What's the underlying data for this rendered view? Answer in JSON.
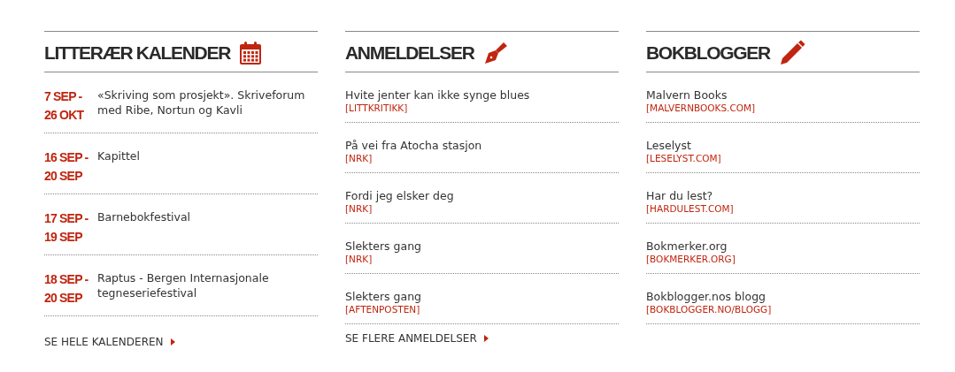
{
  "calendar": {
    "title": "LITTERÆR KALENDER",
    "events": [
      {
        "date_start": "7 SEP -",
        "date_end": "26 OKT",
        "title": "«Skriving som prosjekt». Skriveforum med Ribe, Nortun og Kavli"
      },
      {
        "date_start": "16 SEP -",
        "date_end": "20 SEP",
        "title": "Kapittel"
      },
      {
        "date_start": "17 SEP -",
        "date_end": "19 SEP",
        "title": "Barnebokfestival"
      },
      {
        "date_start": "18 SEP -",
        "date_end": "20 SEP",
        "title": "Raptus - Bergen Internasjonale tegneseriefestival"
      }
    ],
    "more_link": "SE HELE KALENDEREN"
  },
  "reviews": {
    "title": "ANMELDELSER",
    "items": [
      {
        "title": "Hvite jenter kan ikke synge blues",
        "source": "[LITTKRITIKK]"
      },
      {
        "title": "På vei fra Atocha stasjon",
        "source": "[NRK]"
      },
      {
        "title": "Fordi jeg elsker deg",
        "source": "[NRK]"
      },
      {
        "title": "Slekters gang",
        "source": "[NRK]"
      },
      {
        "title": "Slekters gang",
        "source": "[AFTENPOSTEN]"
      }
    ],
    "more_link": "SE FLERE ANMELDELSER"
  },
  "blogs": {
    "title": "BOKBLOGGER",
    "items": [
      {
        "title": "Malvern Books",
        "source": "[MALVERNBOOKS.COM]"
      },
      {
        "title": "Leselyst",
        "source": "[LESELYST.COM]"
      },
      {
        "title": "Har du lest?",
        "source": "[HARDULEST.COM]"
      },
      {
        "title": "Bokmerker.org",
        "source": "[BOKMERKER.ORG]"
      },
      {
        "title": "Bokblogger.nos blogg",
        "source": "[BOKBLOGGER.NO/BLOGG]"
      }
    ]
  }
}
